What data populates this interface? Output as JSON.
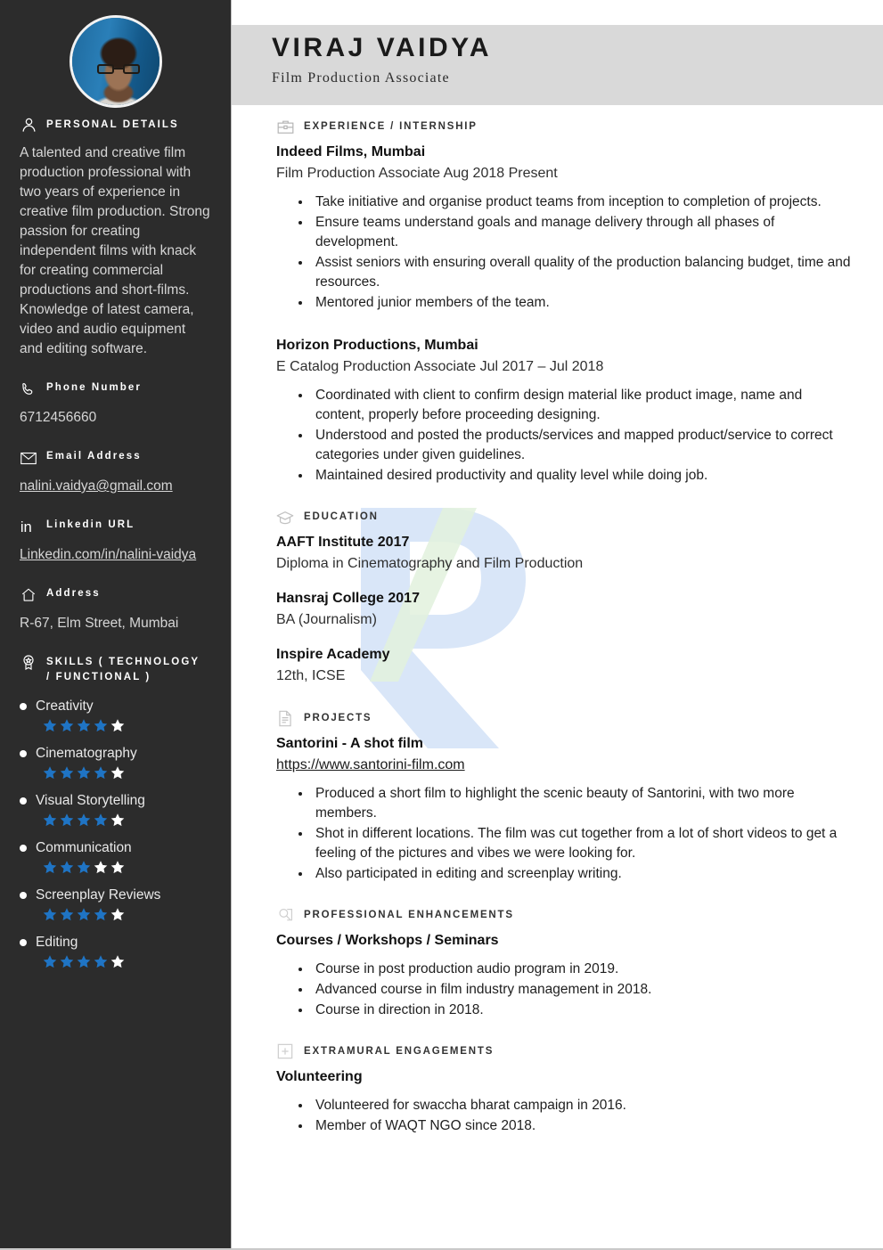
{
  "header": {
    "name": "VIRAJ VAIDYA",
    "role": "Film Production Associate",
    "avatar_icon": "profile-photo"
  },
  "sidebar": {
    "personal_details": {
      "icon": "person-icon",
      "title": "PERSONAL DETAILS",
      "summary": "A talented and creative film production professional with two years of experience in creative film production. Strong passion for creating independent films with knack for creating commercial productions and short-films. Knowledge of latest camera, video and audio equipment and editing software."
    },
    "phone": {
      "icon": "phone-icon",
      "label": "Phone Number",
      "value": "6712456660"
    },
    "email": {
      "icon": "envelope-icon",
      "label": "Email Address",
      "value": "nalini.vaidya@gmail.com"
    },
    "linkedin": {
      "icon": "linkedin-icon",
      "label": "Linkedin URL",
      "value": "Linkedin.com/in/nalini-vaidya"
    },
    "address": {
      "icon": "home-icon",
      "label": "Address",
      "value": "R-67, Elm Street, Mumbai"
    },
    "skills": {
      "icon": "award-badge-icon",
      "title_line1": "SKILLS ( TECHNOLOGY",
      "title_line2": "/ FUNCTIONAL )",
      "star_total": 5,
      "star_filled_color": "#1f74c4",
      "star_empty_color": "#ffffff",
      "items": [
        {
          "name": "Creativity",
          "rating": 4
        },
        {
          "name": "Cinematography",
          "rating": 4
        },
        {
          "name": "Visual Storytelling",
          "rating": 4
        },
        {
          "name": "Communication",
          "rating": 3
        },
        {
          "name": "Screenplay Reviews",
          "rating": 4
        },
        {
          "name": "Editing",
          "rating": 4
        }
      ]
    }
  },
  "main": {
    "experience": {
      "icon": "briefcase-icon",
      "title": "EXPERIENCE / INTERNSHIP",
      "entries": [
        {
          "company": "Indeed Films, Mumbai",
          "meta": "Film Production Associate Aug 2018 Present",
          "bullets": [
            "Take initiative and organise product teams from inception to completion of projects.",
            "Ensure teams understand goals and manage delivery through all phases of development.",
            "Assist seniors with ensuring overall quality of the production balancing budget, time and resources.",
            "Mentored junior members of the team."
          ]
        },
        {
          "company": "Horizon Productions, Mumbai",
          "meta": "E Catalog Production Associate Jul 2017 – Jul 2018",
          "bullets": [
            "Coordinated with client to confirm design material like product image, name and content, properly before proceeding designing.",
            "Understood and posted the products/services and mapped product/service to correct categories under given guidelines.",
            "Maintained desired productivity and quality level while doing job."
          ]
        }
      ]
    },
    "education": {
      "icon": "graduation-cap-icon",
      "title": "EDUCATION",
      "entries": [
        {
          "school": "AAFT Institute 2017",
          "degree": "Diploma in Cinematography and Film Production"
        },
        {
          "school": "Hansraj College 2017",
          "degree": "BA (Journalism)"
        },
        {
          "school": "Inspire Academy",
          "degree": "12th, ICSE"
        }
      ]
    },
    "projects": {
      "icon": "document-icon",
      "title": "PROJECTS",
      "name": "Santorini - A shot film",
      "url": "https://www.santorini-film.com",
      "bullets": [
        "Produced a short film to highlight the scenic beauty of Santorini, with two more members.",
        "Shot in different locations. The film was cut together from a lot of short videos to get a feeling of the pictures and vibes we were looking for.",
        "Also participated in editing and screenplay writing."
      ]
    },
    "professional_enhancements": {
      "icon": "magnifier-document-icon",
      "title": "PROFESSIONAL ENHANCEMENTS",
      "subtitle": "Courses / Workshops / Seminars",
      "bullets": [
        "Course in post production audio program in 2019.",
        "Advanced course in film industry management in 2018.",
        "Course in direction in 2018."
      ]
    },
    "extramural": {
      "icon": "plus-box-icon",
      "title": "EXTRAMURAL ENGAGEMENTS",
      "subtitle": "Volunteering",
      "bullets": [
        "Volunteered for swaccha bharat campaign in 2016.",
        "Member of WAQT NGO since 2018."
      ]
    }
  },
  "watermark": {
    "letter": "R",
    "color_blue": "#d6e4f7",
    "color_green": "#dff0dc"
  }
}
